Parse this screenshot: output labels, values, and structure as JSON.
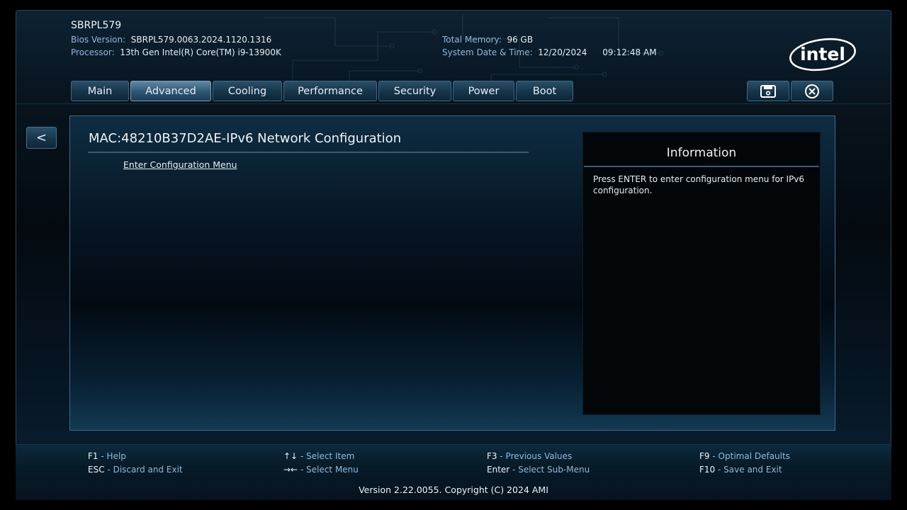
{
  "header": {
    "board_name": "SBRPL579",
    "bios_version_label": "Bios Version:",
    "bios_version": "SBRPL579.0063.2024.1120.1316",
    "processor_label": "Processor:",
    "processor": "13th Gen Intel(R) Core(TM) i9-13900K",
    "memory_label": "Total Memory:",
    "memory": "96 GB",
    "datetime_label": "System Date & Time:",
    "date": "12/20/2024",
    "time": "09:12:48 AM",
    "logo_text": "intel"
  },
  "tabs": [
    {
      "label": "Main"
    },
    {
      "label": "Advanced",
      "active": true
    },
    {
      "label": "Cooling"
    },
    {
      "label": "Performance"
    },
    {
      "label": "Security"
    },
    {
      "label": "Power"
    },
    {
      "label": "Boot"
    }
  ],
  "toolbar": {
    "save_icon": "floppy-disk-icon",
    "exit_icon": "close-circle-icon"
  },
  "nav": {
    "back_label": "<"
  },
  "main": {
    "title": "MAC:48210B37D2AE-IPv6 Network Configuration",
    "items": [
      {
        "label": "Enter Configuration Menu"
      }
    ]
  },
  "info": {
    "title": "Information",
    "text": "Press ENTER to enter configuration menu for IPv6 configuration."
  },
  "footer": {
    "keys": [
      {
        "key": "F1",
        "desc": "Help"
      },
      {
        "key": "ESC",
        "desc": "Discard and Exit"
      },
      {
        "key": "↑↓",
        "desc": "Select Item"
      },
      {
        "key": "→←",
        "desc": "Select Menu"
      },
      {
        "key": "F3",
        "desc": "Previous Values"
      },
      {
        "key": "Enter",
        "desc": "Select Sub-Menu"
      },
      {
        "key": "F9",
        "desc": "Optimal Defaults"
      },
      {
        "key": "F10",
        "desc": "Save and Exit"
      }
    ],
    "version": "Version 2.22.0055. Copyright (C) 2024 AMI"
  },
  "colors": {
    "accent_label": "#8fb9dd",
    "panel_border": "#3e6b86",
    "background": "#000000"
  }
}
